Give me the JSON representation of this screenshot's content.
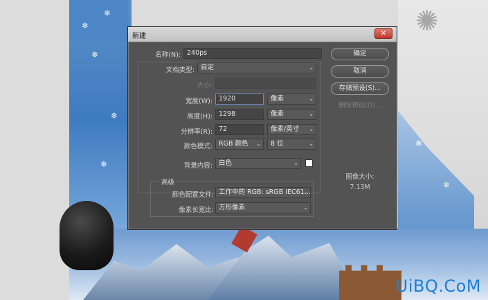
{
  "dialog": {
    "title": "新建",
    "close_glyph": "✕"
  },
  "form": {
    "name_label": "名称(N):",
    "name_value": "240ps",
    "doc_type_label": "文档类型:",
    "doc_type_value": "自定",
    "size_label": "大小:",
    "size_value": "",
    "width_label": "宽度(W):",
    "width_value": "1920",
    "width_unit": "像素",
    "height_label": "高度(H):",
    "height_value": "1298",
    "height_unit": "像素",
    "resolution_label": "分辨率(R):",
    "resolution_value": "72",
    "resolution_unit": "像素/英寸",
    "color_mode_label": "颜色模式:",
    "color_mode_value": "RGB 颜色",
    "bit_depth_value": "8 位",
    "background_label": "背景内容:",
    "background_value": "白色",
    "background_swatch_color": "#ffffff"
  },
  "advanced": {
    "title": "高级",
    "color_profile_label": "颜色配置文件:",
    "color_profile_value": "工作中的 RGB: sRGB IEC61...",
    "pixel_aspect_label": "像素长宽比:",
    "pixel_aspect_value": "方形像素"
  },
  "buttons": {
    "ok": "确定",
    "cancel": "取消",
    "save_preset": "存储预设(S)...",
    "delete_preset": "删除预设(D)..."
  },
  "image_size": {
    "title": "图像大小:",
    "value": "7.13M"
  },
  "background": {
    "watermark": "UiBQ.CoM",
    "flake_glyph": "❄",
    "firework_glyph": "✺"
  },
  "icons": {
    "chevron": "chevron-down-icon",
    "close": "close-icon"
  },
  "colors": {
    "dialog_bg": "#535353",
    "close_button": "#c4362a",
    "watermark": "#1e7fd6"
  }
}
